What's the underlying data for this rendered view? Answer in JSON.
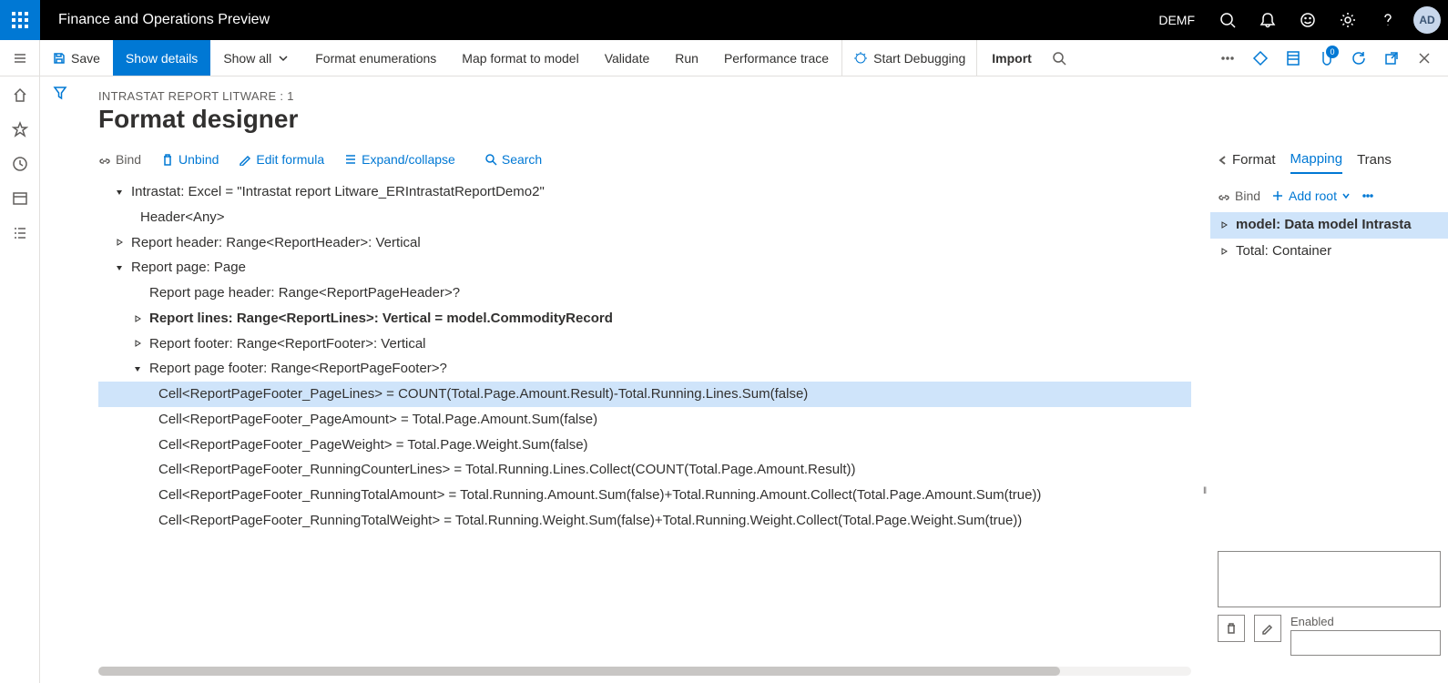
{
  "topbar": {
    "app_title": "Finance and Operations Preview",
    "company": "DEMF",
    "avatar": "AD"
  },
  "cmdbar": {
    "save": "Save",
    "show_details": "Show details",
    "show_all": "Show all",
    "format_enum": "Format enumerations",
    "map_format": "Map format to model",
    "validate": "Validate",
    "run": "Run",
    "perf_trace": "Performance trace",
    "start_debugging": "Start Debugging",
    "import": "Import",
    "attach_badge": "0"
  },
  "breadcrumb": "INTRASTAT REPORT LITWARE : 1",
  "page_title": "Format designer",
  "tools": {
    "bind": "Bind",
    "unbind": "Unbind",
    "edit_formula": "Edit formula",
    "expand": "Expand/collapse",
    "search": "Search"
  },
  "tree": {
    "root": "Intrastat: Excel = \"Intrastat report Litware_ERIntrastatReportDemo2\"",
    "header": "Header<Any>",
    "report_header": "Report header: Range<ReportHeader>: Vertical",
    "report_page": "Report page: Page",
    "page_header": "Report page header: Range<ReportPageHeader>?",
    "report_lines": "Report lines: Range<ReportLines>: Vertical = model.CommodityRecord",
    "report_footer": "Report footer: Range<ReportFooter>: Vertical",
    "page_footer": "Report page footer: Range<ReportPageFooter>?",
    "cell1": "Cell<ReportPageFooter_PageLines> = COUNT(Total.Page.Amount.Result)-Total.Running.Lines.Sum(false)",
    "cell2": "Cell<ReportPageFooter_PageAmount> = Total.Page.Amount.Sum(false)",
    "cell3": "Cell<ReportPageFooter_PageWeight> = Total.Page.Weight.Sum(false)",
    "cell4": "Cell<ReportPageFooter_RunningCounterLines> = Total.Running.Lines.Collect(COUNT(Total.Page.Amount.Result))",
    "cell5": "Cell<ReportPageFooter_RunningTotalAmount> = Total.Running.Amount.Sum(false)+Total.Running.Amount.Collect(Total.Page.Amount.Sum(true))",
    "cell6": "Cell<ReportPageFooter_RunningTotalWeight> = Total.Running.Weight.Sum(false)+Total.Running.Weight.Collect(Total.Page.Weight.Sum(true))"
  },
  "right_panel": {
    "tab_format": "Format",
    "tab_mapping": "Mapping",
    "tab_trans": "Trans",
    "bind": "Bind",
    "add_root": "Add root",
    "tree_model": "model: Data model Intrasta",
    "tree_total": "Total: Container",
    "enabled_label": "Enabled"
  }
}
